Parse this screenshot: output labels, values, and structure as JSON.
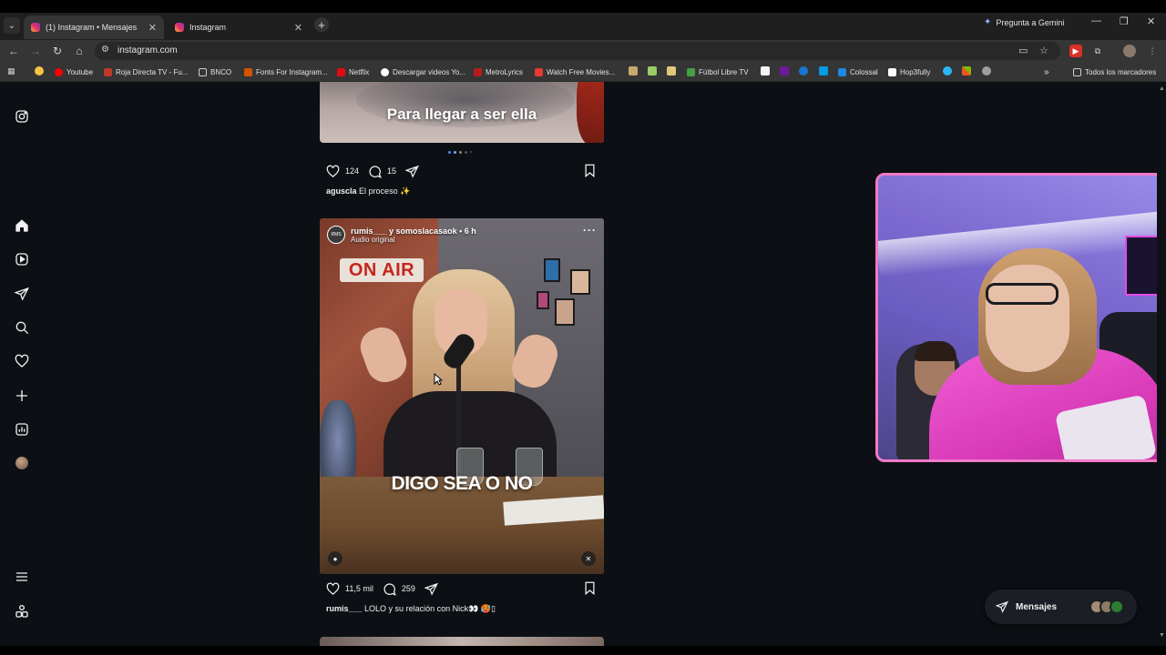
{
  "browser": {
    "tabs": [
      {
        "title": "(1) Instagram • Mensajes",
        "close": "✕"
      },
      {
        "title": "Instagram",
        "close": "✕"
      }
    ],
    "new_tab": "+",
    "gemini_label": "Pregunta a Gemini",
    "url": "instagram.com",
    "window_controls": [
      "—",
      "❐",
      "✕"
    ],
    "bookmarks": [
      {
        "label": "Youtube",
        "color": "#ff0000"
      },
      {
        "label": "Roja Directa TV - Fu...",
        "color": "#c0392b"
      },
      {
        "label": "BNCO",
        "color": "#f5c518"
      },
      {
        "label": "Fonts For Instagram...",
        "color": "#d35400"
      },
      {
        "label": "Netflix",
        "color": "#e50914"
      },
      {
        "label": "Descargar videos Yo...",
        "color": "#ffffff"
      },
      {
        "label": "MetroLyrics",
        "color": "#b71c1c"
      },
      {
        "label": "Watch Free Movies...",
        "color": "#e53935"
      },
      {
        "label": "Fútbol Libre TV",
        "color": "#43a047"
      },
      {
        "label": "Colossal",
        "color": "#1e88e5"
      },
      {
        "label": "Hop3fully",
        "color": "#ffffff"
      }
    ],
    "all_bookmarks": "Todos los marcadores",
    "overflow": "»"
  },
  "post1": {
    "overlay_text": "Para llegar a ser ella",
    "likes": "124",
    "comments": "15",
    "caption_user": "aguscla",
    "caption_text": "El proceso ✨"
  },
  "post2": {
    "header_user": "rumis___ y somoslacasaok • 6 h",
    "header_audio": "Audio original",
    "avatar_text": "RMS",
    "sign_text": "ON AIR",
    "overlay_text": "DIGO SEA O NO",
    "likes": "11,5 mil",
    "comments": "259",
    "caption_user": "rumis___",
    "caption_text": "LOLO y su relación con Nick👀 🥵▯"
  },
  "messages": {
    "label": "Mensajes"
  },
  "colors": {
    "page_bg": "#0c0f14",
    "cam_border": "#f07ac8",
    "instagram_gradient": [
      "#f9b333",
      "#e1306c",
      "#833ab4"
    ]
  },
  "icons": [
    "instagram-icon",
    "home-icon",
    "reels-icon",
    "send-icon",
    "search-icon",
    "heart-icon",
    "plus-icon",
    "dashboard-icon",
    "menu-icon",
    "meta-threads-icon",
    "comment-icon",
    "bookmark-icon",
    "mute-icon",
    "tag-user-icon"
  ]
}
